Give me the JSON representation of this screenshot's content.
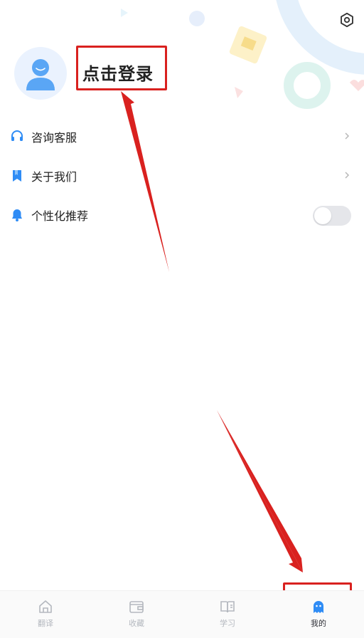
{
  "header": {
    "login_label": "点击登录"
  },
  "menu": {
    "items": [
      {
        "label": "咨询客服",
        "icon": "headset-icon"
      },
      {
        "label": "关于我们",
        "icon": "bookmark-icon"
      },
      {
        "label": "个性化推荐",
        "icon": "bell-icon"
      }
    ],
    "personalized_enabled": false
  },
  "tabs": [
    {
      "label": "翻译",
      "icon": "home-icon",
      "active": false
    },
    {
      "label": "收藏",
      "icon": "wallet-icon",
      "active": false
    },
    {
      "label": "学习",
      "icon": "book-icon",
      "active": false
    },
    {
      "label": "我的",
      "icon": "ghost-profile-icon",
      "active": true
    }
  ],
  "colors": {
    "accent": "#2f8cf5",
    "annotation": "#d9211f",
    "toggle_off": "#e5e6ea",
    "tab_inactive": "#b4b8bf"
  }
}
